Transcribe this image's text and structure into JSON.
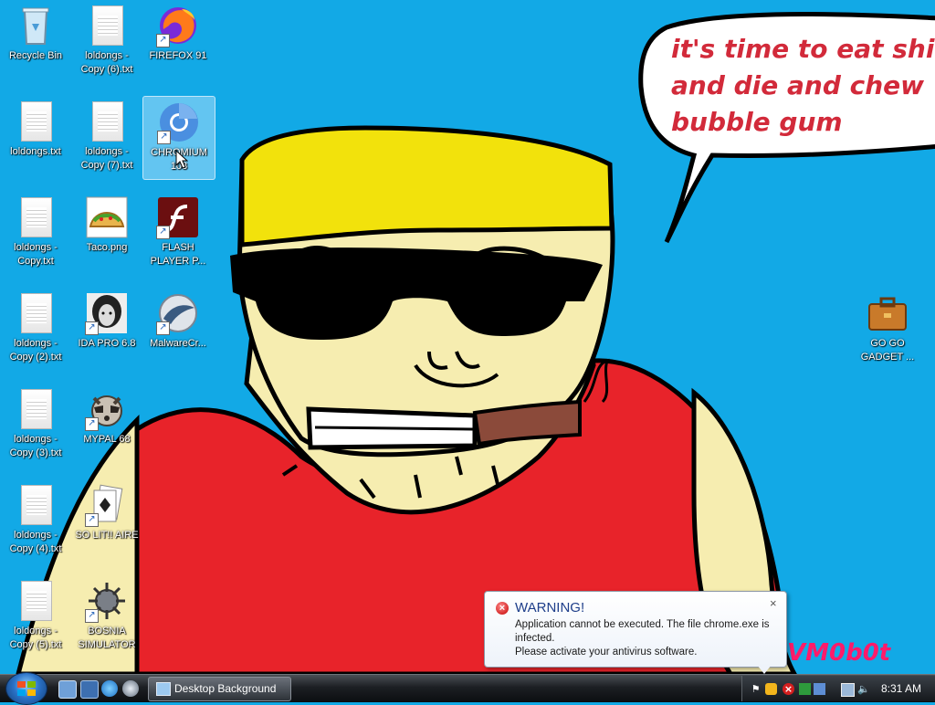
{
  "desktop": {
    "speech_bubble": {
      "lines": [
        "it's time to eat shit",
        "and die and chew",
        "bubble gum"
      ]
    },
    "signature": "VM0b0t",
    "icons": [
      {
        "name": "recycle-bin",
        "label": "Recycle Bin",
        "type": "recycle",
        "shortcut": false
      },
      {
        "name": "loldongs-copy-6",
        "label": "loldongs - Copy (6).txt",
        "type": "txt",
        "shortcut": false
      },
      {
        "name": "firefox-91",
        "label": "FIREFOX 91",
        "type": "firefox",
        "shortcut": true
      },
      {
        "name": "loldongs",
        "label": "loldongs.txt",
        "type": "txt",
        "shortcut": false
      },
      {
        "name": "loldongs-copy-7",
        "label": "loldongs - Copy (7).txt",
        "type": "txt",
        "shortcut": false
      },
      {
        "name": "chromium",
        "label": "CHROMIUM 103",
        "type": "chromium",
        "shortcut": true
      },
      {
        "name": "loldongs-copy",
        "label": "loldongs - Copy.txt",
        "type": "txt",
        "shortcut": false
      },
      {
        "name": "taco",
        "label": "Taco.png",
        "type": "taco",
        "shortcut": false
      },
      {
        "name": "flash-player",
        "label": "FLASH PLAYER P...",
        "type": "flash",
        "shortcut": true
      },
      {
        "name": "loldongs-copy-2",
        "label": "loldongs - Copy (2).txt",
        "type": "txt",
        "shortcut": false
      },
      {
        "name": "ida-pro",
        "label": "IDA PRO 6.8",
        "type": "ida",
        "shortcut": true
      },
      {
        "name": "malwarecrusher",
        "label": "MalwareCr...",
        "type": "malware",
        "shortcut": true
      },
      {
        "name": "loldongs-copy-3",
        "label": "loldongs - Copy (3).txt",
        "type": "txt",
        "shortcut": false
      },
      {
        "name": "mypal",
        "label": "MYPAL 68",
        "type": "mypal",
        "shortcut": true
      },
      {
        "name": "loldongs-copy-4",
        "label": "loldongs - Copy (4).txt",
        "type": "txt",
        "shortcut": false
      },
      {
        "name": "solitaire",
        "label": "SO LIT!! AIRE",
        "type": "solitaire",
        "shortcut": true
      },
      {
        "name": "loldongs-copy-5",
        "label": "loldongs - Copy (5).txt",
        "type": "txt",
        "shortcut": false
      },
      {
        "name": "bosnia-simulator",
        "label": "BOSNIA SIMULATOR",
        "type": "bosnia",
        "shortcut": true
      },
      {
        "name": "go-go-gadget",
        "label": "GO GO GADGET ...",
        "type": "briefcase",
        "shortcut": false
      }
    ]
  },
  "notification": {
    "title": "WARNING!",
    "line1": "Application cannot be executed. The file chrome.exe is infected.",
    "line2": "Please activate your antivirus software.",
    "close": "×"
  },
  "taskbar": {
    "active_window": "Desktop Background",
    "clock": "8:31 AM"
  },
  "colors": {
    "desktop_bg": "#12a9e6",
    "shirt": "#e8232a",
    "hair": "#f2e20c",
    "skin": "#f6edb0",
    "bubble_text": "#d22a3a",
    "signature": "#ff1b6a"
  }
}
